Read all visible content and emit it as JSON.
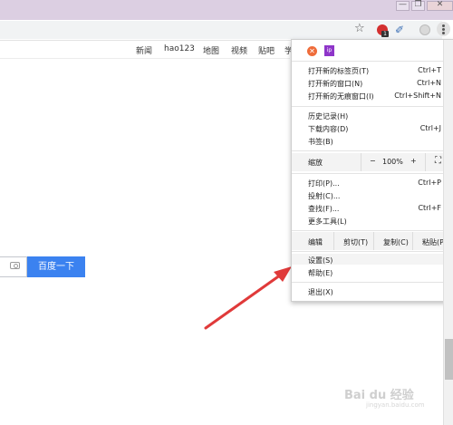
{
  "window": {
    "min_glyph": "—",
    "max_glyph": "❐",
    "close_glyph": "✕"
  },
  "toolbar": {
    "star_glyph": "☆",
    "ext_badge": "1",
    "ext2_glyph": "✐"
  },
  "nav": {
    "items": [
      "新闻",
      "hao123",
      "地图",
      "视频",
      "贴吧",
      "学"
    ]
  },
  "search": {
    "button_label": "百度一下"
  },
  "menu": {
    "ext_o": "✕",
    "ext_p": "ip",
    "new_tab": "打开新的标签页(T)",
    "new_tab_sc": "Ctrl+T",
    "new_window": "打开新的窗口(N)",
    "new_window_sc": "Ctrl+N",
    "incognito": "打开新的无痕窗口(I)",
    "incognito_sc": "Ctrl+Shift+N",
    "history": "历史记录(H)",
    "downloads": "下载内容(D)",
    "downloads_sc": "Ctrl+J",
    "bookmarks": "书签(B)",
    "zoom_label": "缩放",
    "zoom_minus": "−",
    "zoom_value": "100%",
    "zoom_plus": "+",
    "fullscreen": "⛶",
    "print": "打印(P)...",
    "print_sc": "Ctrl+P",
    "cast": "投射(C)...",
    "find": "查找(F)...",
    "find_sc": "Ctrl+F",
    "more_tools": "更多工具(L)",
    "edit_label": "编辑",
    "cut": "剪切(T)",
    "copy": "复制(C)",
    "paste": "粘贴(P)",
    "settings": "设置(S)",
    "help": "帮助(E)",
    "exit": "退出(X)"
  },
  "annotation": {
    "arrow_color": "#e03a3a"
  },
  "watermark": {
    "text": "Bai du 经验",
    "sub": "jingyan.baidu.com"
  }
}
